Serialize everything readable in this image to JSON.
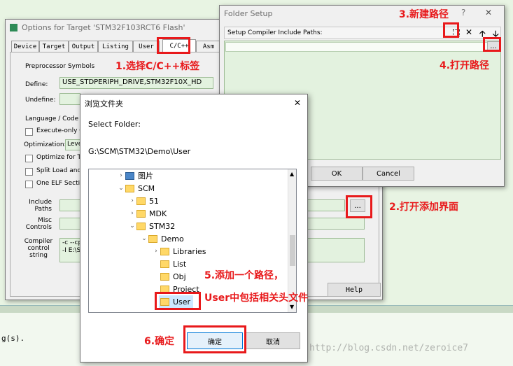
{
  "options_window": {
    "title": "Options for Target 'STM32F103RCT6 Flash'",
    "tabs": [
      "Device",
      "Target",
      "Output",
      "Listing",
      "User",
      "C/C++",
      "Asm"
    ],
    "preproc_group": "Preprocessor Symbols",
    "define_label": "Define:",
    "define_value": "USE_STDPERIPH_DRIVE,STM32F10X_HD",
    "undefine_label": "Undefine:",
    "lang_group": "Language / Code Ge",
    "execute_only": "Execute-only Co",
    "optimization_label": "Optimization:",
    "optimization_value": "Leve",
    "optimize_time": "Optimize for Tim",
    "split_load": "Split Load and S",
    "one_elf": "One ELF Section",
    "include_paths_label": "Include\nPaths",
    "misc_controls_label": "Misc\nControls",
    "compiler_control_label": "Compiler\ncontrol\nstring",
    "compiler_line1": "-c --cpu",
    "compiler_line2": "-I E:\\Sc",
    "browse_label": "...",
    "help_label": "Help"
  },
  "folder_setup": {
    "title": "Folder Setup",
    "help_glyph": "?",
    "close_glyph": "✕",
    "header_label": "Setup Compiler Include Paths:",
    "browse_label": "...",
    "ok_label": "OK",
    "cancel_label": "Cancel"
  },
  "browse_dialog": {
    "title": "浏览文件夹",
    "close_glyph": "✕",
    "select_folder_label": "Select Folder:",
    "path": "G:\\SCM\\STM32\\Demo\\User",
    "tree": [
      {
        "label": "图片",
        "level": 0,
        "expander": "›",
        "icon": "picture"
      },
      {
        "label": "SCM",
        "level": 0,
        "expander": "⌄",
        "icon": "folder"
      },
      {
        "label": "51",
        "level": 1,
        "expander": "›",
        "icon": "folder"
      },
      {
        "label": "MDK",
        "level": 1,
        "expander": "›",
        "icon": "folder"
      },
      {
        "label": "STM32",
        "level": 1,
        "expander": "⌄",
        "icon": "folder"
      },
      {
        "label": "Demo",
        "level": 2,
        "expander": "⌄",
        "icon": "folder"
      },
      {
        "label": "Libraries",
        "level": 3,
        "expander": "›",
        "icon": "folder"
      },
      {
        "label": "List",
        "level": 3,
        "expander": "",
        "icon": "folder"
      },
      {
        "label": "Obj",
        "level": 3,
        "expander": "",
        "icon": "folder"
      },
      {
        "label": "Project",
        "level": 3,
        "expander": "",
        "icon": "folder"
      },
      {
        "label": "User",
        "level": 3,
        "expander": "",
        "icon": "folder",
        "selected": true
      }
    ],
    "ok_label": "确定",
    "cancel_label": "取消"
  },
  "background_window": {
    "text_line": "g(s)."
  },
  "annotations": {
    "step1": "1.选择C/C++标签",
    "step2": "2.打开添加界面",
    "step3": "3.新建路径",
    "step4": "4.打开路径",
    "step5a": "5.添加一个路径，",
    "step5b": "User中包括相关头文件",
    "step6": "6.确定"
  },
  "watermark": "http://blog.csdn.net/zeroice7",
  "colors": {
    "annotation": "#e8191b",
    "field": "#e3f2df",
    "selected": "#cce8ff"
  }
}
